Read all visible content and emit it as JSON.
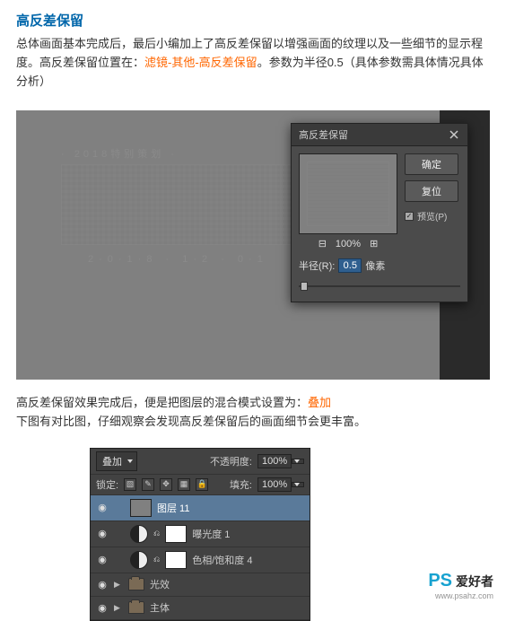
{
  "section1": {
    "heading": "高反差保留",
    "body_pre": "总体画面基本完成后，最后小编加上了高反差保留以增强画面的纹理以及一些细节的显示程度。高反差保留位置在：",
    "body_orange": "滤镜-其他-高反差保留",
    "body_post": "。参数为半径0.5（具体参数需具体情况具体分析）"
  },
  "canvas": {
    "faint_text_top": "· 2018特别策划 ·",
    "faint_text_bottom": "2·0·1·8 · 1·2 · 0·1"
  },
  "dialog": {
    "title": "高反差保留",
    "btn_ok": "确定",
    "btn_reset": "复位",
    "preview_label": "预览(P)",
    "zoom_minus": "⊟",
    "zoom_value": "100%",
    "zoom_plus": "⊞",
    "radius_label": "半径(R):",
    "radius_value": "0.5",
    "radius_unit": "像素"
  },
  "section2": {
    "line1_pre": "高反差保留效果完成后，便是把图层的混合模式设置为：",
    "line1_orange": "叠加",
    "line2": "下图有对比图，仔细观察会发现高反差保留后的画面细节会更丰富。"
  },
  "layers": {
    "blend_mode": "叠加",
    "opacity_label": "不透明度:",
    "opacity_value": "100%",
    "lock_label": "锁定:",
    "fill_label": "填充:",
    "fill_value": "100%",
    "items": [
      {
        "name": "图层 11",
        "kind": "pixel",
        "selected": true
      },
      {
        "name": "曝光度 1",
        "kind": "adjust"
      },
      {
        "name": "色相/饱和度 4",
        "kind": "adjust"
      },
      {
        "name": "光效",
        "kind": "folder"
      },
      {
        "name": "主体",
        "kind": "folder"
      }
    ]
  },
  "watermark": {
    "brand": "PS",
    "zh": "爱好者",
    "url": "www.psahz.com"
  }
}
